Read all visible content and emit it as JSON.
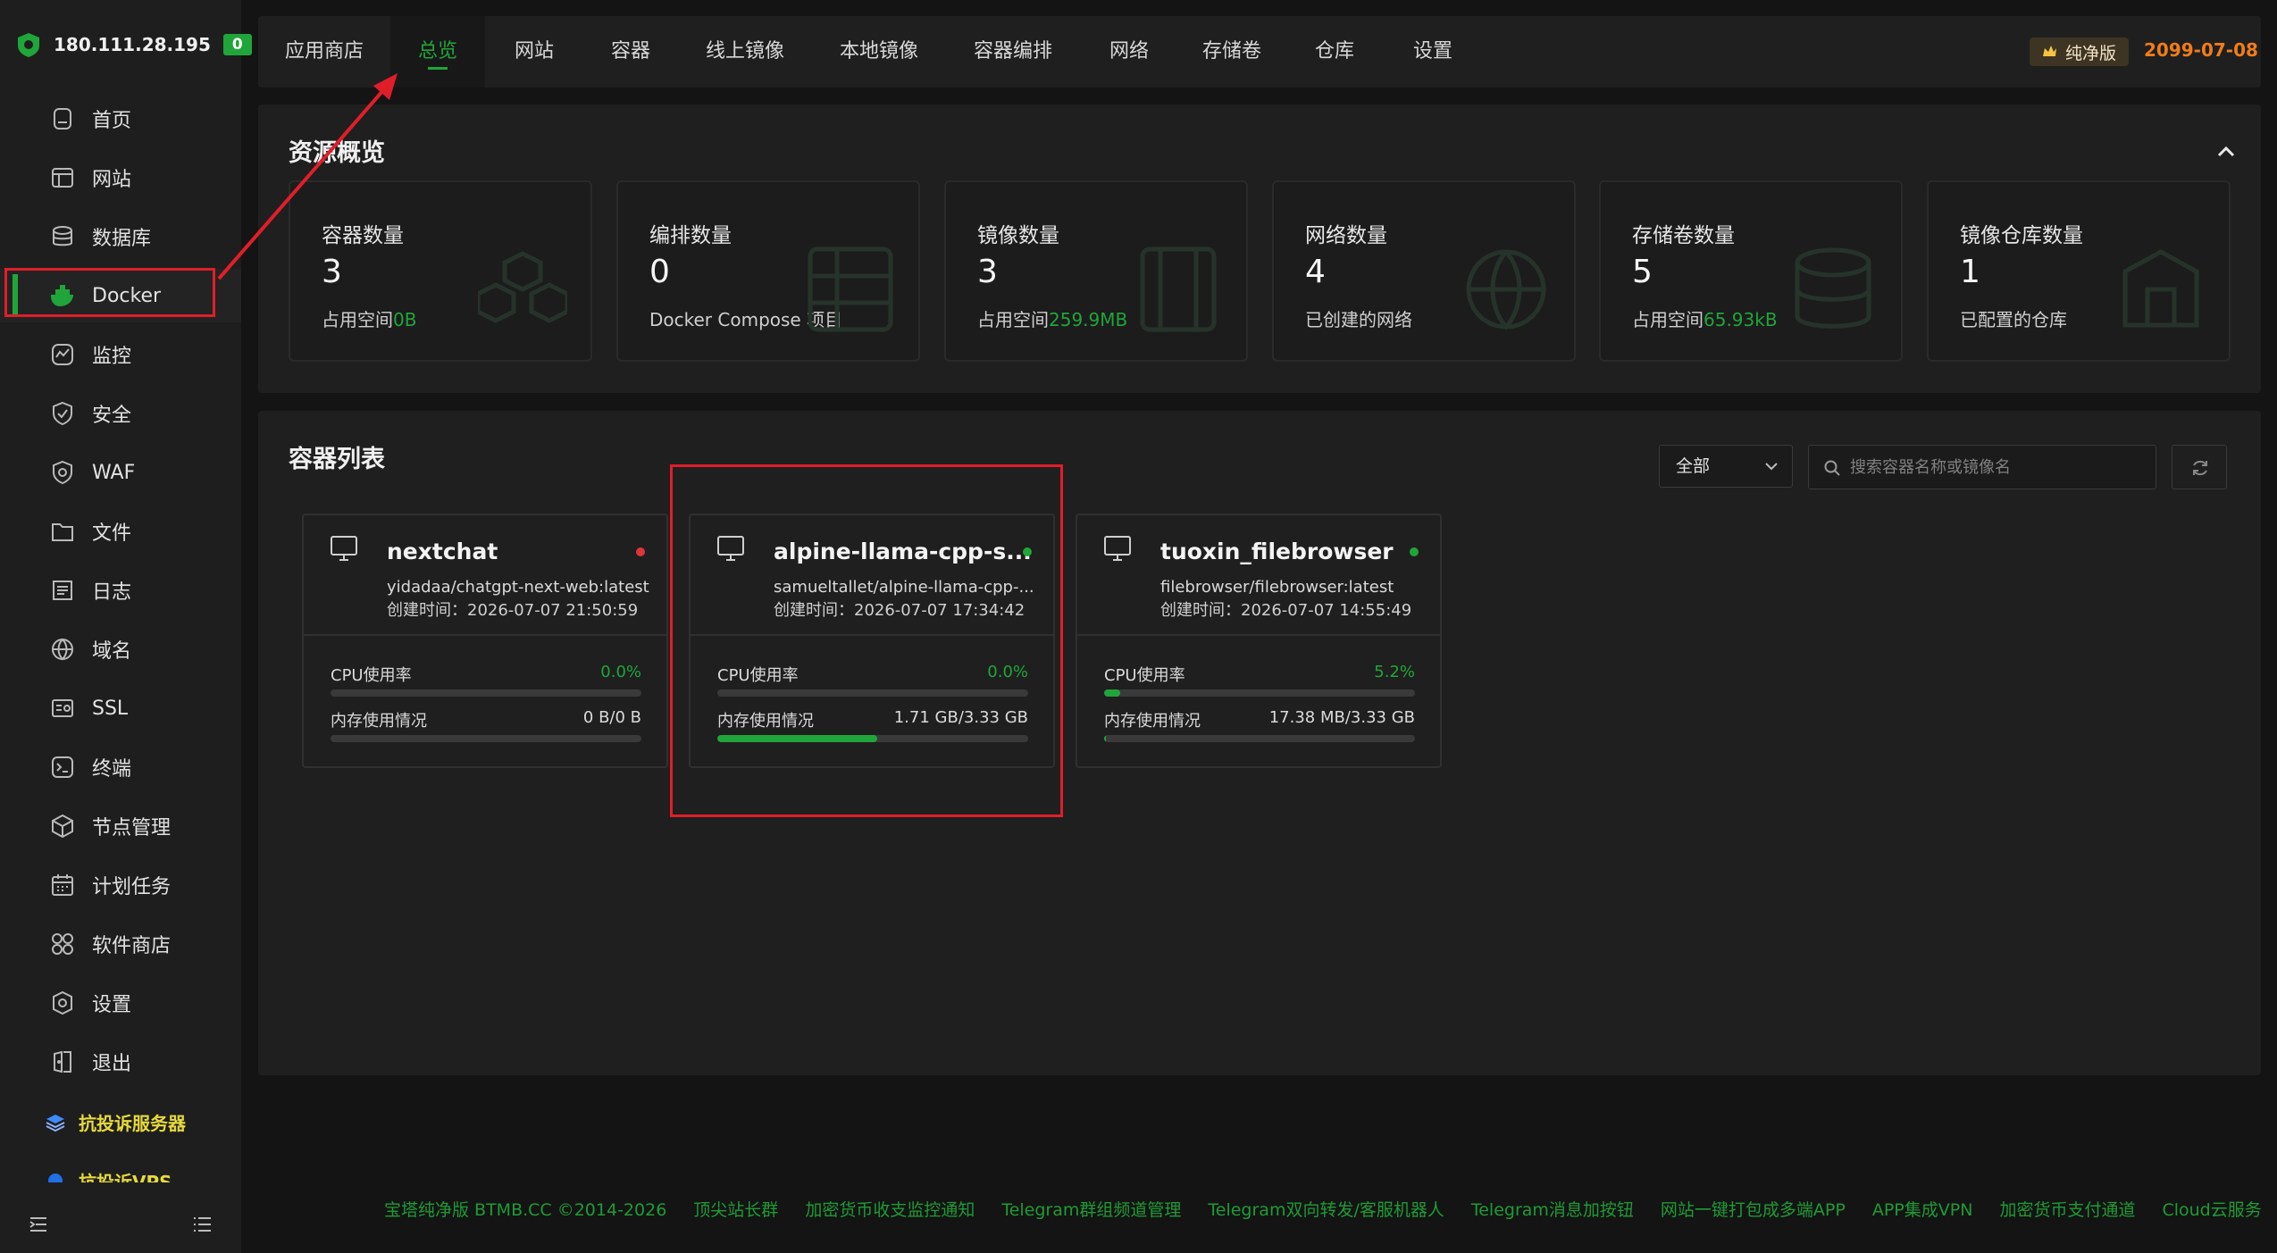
{
  "server": {
    "ip": "180.111.28.195",
    "badge": "0"
  },
  "sidebar": {
    "items": [
      {
        "label": "首页",
        "icon": "home-icon"
      },
      {
        "label": "网站",
        "icon": "website-icon"
      },
      {
        "label": "数据库",
        "icon": "database-icon"
      },
      {
        "label": "Docker",
        "icon": "docker-icon",
        "active": true
      },
      {
        "label": "监控",
        "icon": "monitor-chart-icon"
      },
      {
        "label": "安全",
        "icon": "shield-icon"
      },
      {
        "label": "WAF",
        "icon": "waf-icon"
      },
      {
        "label": "文件",
        "icon": "folder-icon"
      },
      {
        "label": "日志",
        "icon": "log-icon"
      },
      {
        "label": "域名",
        "icon": "globe-icon"
      },
      {
        "label": "SSL",
        "icon": "ssl-icon"
      },
      {
        "label": "终端",
        "icon": "terminal-icon"
      },
      {
        "label": "节点管理",
        "icon": "node-icon"
      },
      {
        "label": "计划任务",
        "icon": "calendar-icon"
      },
      {
        "label": "软件商店",
        "icon": "apps-icon"
      },
      {
        "label": "设置",
        "icon": "settings-icon"
      },
      {
        "label": "退出",
        "icon": "logout-icon"
      }
    ],
    "promo1": "抗投诉服务器",
    "promo2": "抗投诉VPS"
  },
  "tabs": [
    "应用商店",
    "总览",
    "网站",
    "容器",
    "线上镜像",
    "本地镜像",
    "容器编排",
    "网络",
    "存储卷",
    "仓库",
    "设置"
  ],
  "active_tab": "总览",
  "edition_badge": "纯净版",
  "expire_date": "2099-07-08",
  "overview": {
    "title": "资源概览",
    "cards": [
      {
        "label": "容器数量",
        "value": "3",
        "sub_prefix": "占用空间",
        "sub_value": "0B",
        "icon": "boxes-icon"
      },
      {
        "label": "编排数量",
        "value": "0",
        "sub_prefix": "Docker Compose 项目",
        "sub_value": "",
        "icon": "compose-icon"
      },
      {
        "label": "镜像数量",
        "value": "3",
        "sub_prefix": "占用空间",
        "sub_value": "259.9MB",
        "icon": "image-icon"
      },
      {
        "label": "网络数量",
        "value": "4",
        "sub_prefix": "已创建的网络",
        "sub_value": "",
        "icon": "network-icon"
      },
      {
        "label": "存储卷数量",
        "value": "5",
        "sub_prefix": "占用空间",
        "sub_value": "65.93kB",
        "icon": "volume-icon"
      },
      {
        "label": "镜像仓库数量",
        "value": "1",
        "sub_prefix": "已配置的仓库",
        "sub_value": "",
        "icon": "registry-icon"
      }
    ]
  },
  "containers": {
    "title": "容器列表",
    "filter": "全部",
    "search_placeholder": "搜索容器名称或镜像名",
    "items": [
      {
        "name": "nextchat",
        "status_color": "#e0343a",
        "image": "yidadaa/chatgpt-next-web:latest",
        "created": "创建时间：2026-07-07 21:50:59",
        "cpu_label": "CPU使用率",
        "cpu": "0.0%",
        "cpu_frac": 0.0,
        "mem_label": "内存使用情况",
        "mem": "0 B/0 B",
        "mem_frac": 0.0
      },
      {
        "name": "alpine-llama-cpp-s...",
        "status_color": "#20a53a",
        "image": "samueltallet/alpine-llama-cpp-...",
        "created": "创建时间：2026-07-07 17:34:42",
        "cpu_label": "CPU使用率",
        "cpu": "0.0%",
        "cpu_frac": 0.0,
        "mem_label": "内存使用情况",
        "mem": "1.71 GB/3.33 GB",
        "mem_frac": 0.513
      },
      {
        "name": "tuoxin_filebrowser",
        "status_color": "#20a53a",
        "image": "filebrowser/filebrowser:latest",
        "created": "创建时间：2026-07-07 14:55:49",
        "cpu_label": "CPU使用率",
        "cpu": "5.2%",
        "cpu_frac": 0.052,
        "mem_label": "内存使用情况",
        "mem": "17.38 MB/3.33 GB",
        "mem_frac": 0.005
      }
    ]
  },
  "footer": [
    "宝塔纯净版 BTMB.CC ©2014-2026",
    "顶尖站长群",
    "加密货币收支监控通知",
    "Telegram群组频道管理",
    "Telegram双向转发/客服机器人",
    "Telegram消息加按钮",
    "网站一键打包成多端APP",
    "APP集成VPN",
    "加密货币支付通道",
    "Cloud云服务"
  ],
  "colors": {
    "accent": "#20a53a",
    "highlight": "#e01e2a",
    "expire": "#ef7d1a"
  }
}
